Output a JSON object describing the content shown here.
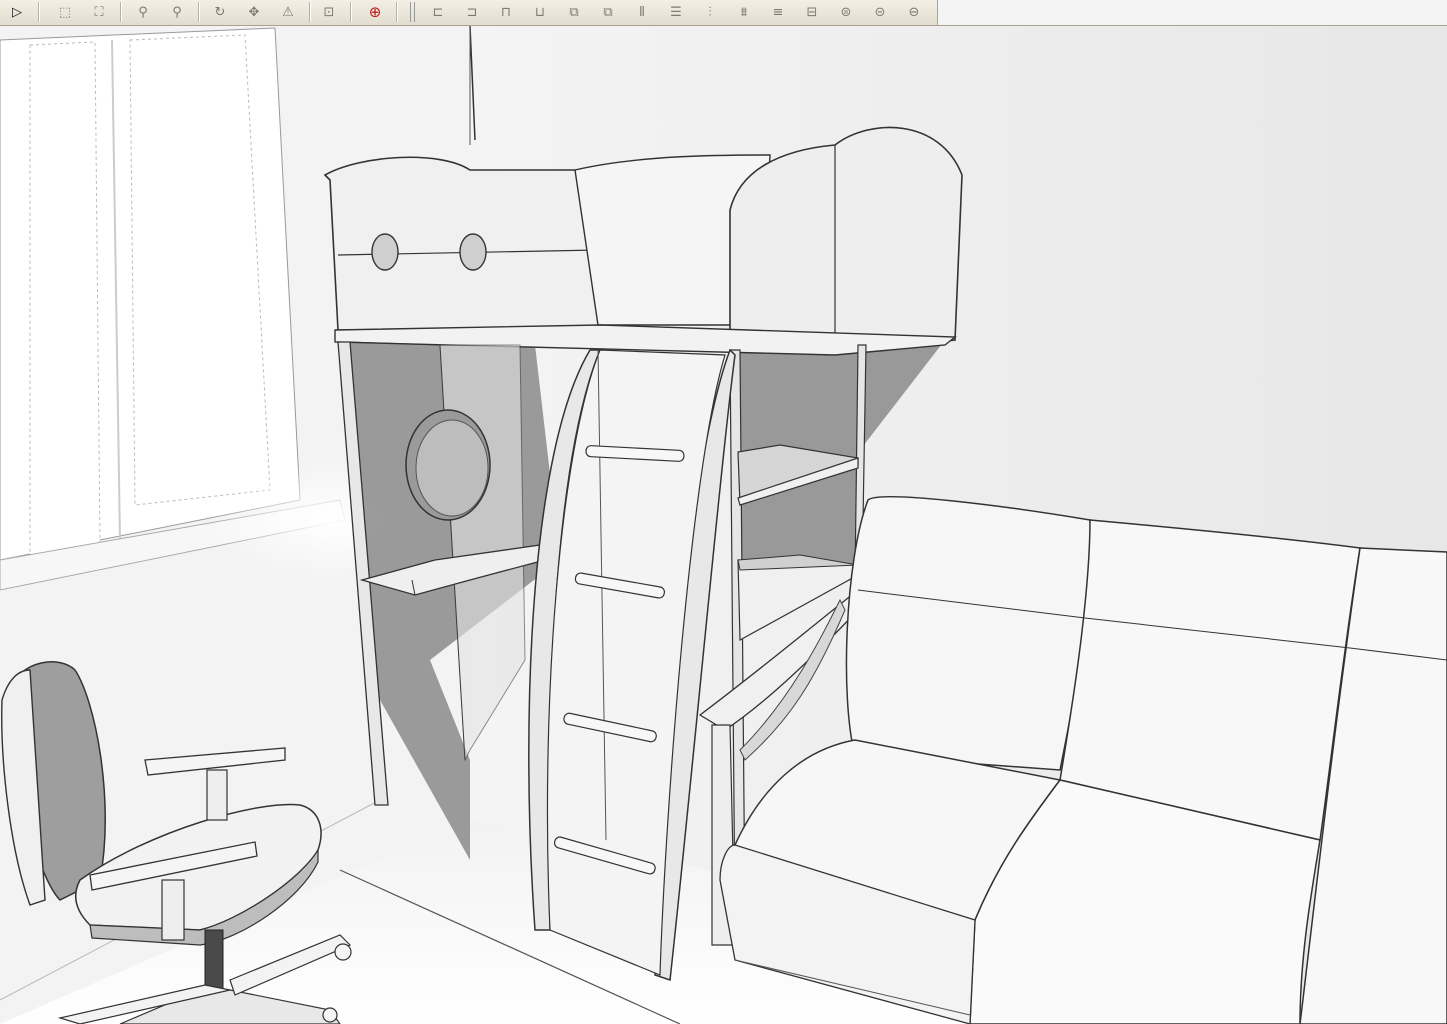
{
  "toolbar": {
    "groups": [
      {
        "id": "select",
        "buttons": [
          {
            "name": "select-arrow-icon",
            "glyph": "▷"
          }
        ]
      },
      {
        "id": "view",
        "buttons": [
          {
            "name": "zoom-window-icon",
            "glyph": "⬚"
          },
          {
            "name": "zoom-extents-icon",
            "glyph": "⛶"
          }
        ]
      },
      {
        "id": "walk",
        "buttons": [
          {
            "name": "position-camera-icon",
            "glyph": "⚲"
          },
          {
            "name": "look-around-icon",
            "glyph": "⚲"
          }
        ]
      },
      {
        "id": "modify",
        "buttons": [
          {
            "name": "rotate-icon",
            "glyph": "↻"
          },
          {
            "name": "move-icon",
            "glyph": "✥"
          },
          {
            "name": "section-plane-icon",
            "glyph": "⚠"
          }
        ]
      },
      {
        "id": "layers",
        "buttons": [
          {
            "name": "layer-icon",
            "glyph": "⊡"
          }
        ]
      },
      {
        "id": "help",
        "buttons": [
          {
            "name": "help-lifebuoy-icon",
            "glyph": "⊕"
          }
        ]
      },
      {
        "id": "align",
        "buttons": [
          {
            "name": "align-left-icon",
            "glyph": "⊏"
          },
          {
            "name": "align-right-icon",
            "glyph": "⊐"
          },
          {
            "name": "align-top-icon",
            "glyph": "⊓"
          },
          {
            "name": "align-bottom-icon",
            "glyph": "⊔"
          },
          {
            "name": "align-front-icon",
            "glyph": "⧉"
          },
          {
            "name": "align-back-icon",
            "glyph": "⧉"
          },
          {
            "name": "distribute-horizontal-icon",
            "glyph": "⫴"
          },
          {
            "name": "distribute-vertical-icon",
            "glyph": "☰"
          },
          {
            "name": "distribute-depth-icon",
            "glyph": "⫶"
          },
          {
            "name": "space-horizontal-icon",
            "glyph": "⩩"
          },
          {
            "name": "space-vertical-icon",
            "glyph": "≡"
          },
          {
            "name": "space-depth-icon",
            "glyph": "⊟"
          },
          {
            "name": "stack-icon",
            "glyph": "⊜"
          },
          {
            "name": "group-icon",
            "glyph": "⊝"
          },
          {
            "name": "lock-icon",
            "glyph": "⊖"
          }
        ]
      }
    ]
  },
  "colors": {
    "toolbar_bg": "#ebe6da",
    "viewport_bg": "#ffffff",
    "wall_shade": "#e6e6e6",
    "model_shadow": "#7e7e7e",
    "model_fill": "#efefef",
    "edge_color": "#3b3b3b",
    "help_icon": "#b71616"
  },
  "scene": {
    "objects": [
      "window",
      "loft-bed",
      "ladder",
      "desk-shelf",
      "side-shelves",
      "sofa",
      "office-chair"
    ]
  }
}
